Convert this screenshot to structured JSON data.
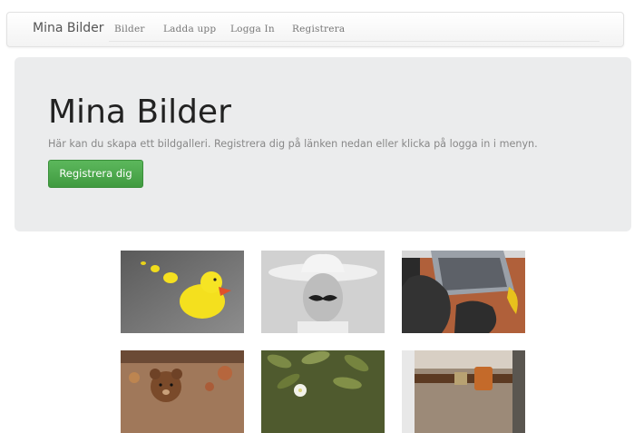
{
  "navbar": {
    "brand": "Mina Bilder",
    "items": [
      "Bilder",
      "Ladda upp",
      "Logga In",
      "Registrera"
    ]
  },
  "hero": {
    "title": "Mina Bilder",
    "text": "Här kan du skapa ett bildgalleri. Registrera dig på länken nedan eller klicka på logga in i menyn.",
    "button_label": "Registrera dig"
  },
  "gallery": {
    "images": [
      "rubber-ducks-photo",
      "cowboy-mustache-photo",
      "gorilla-laptop-photo",
      "teddy-bear-photo",
      "succulent-plant-photo",
      "belt-holster-photo"
    ]
  },
  "colors": {
    "button_green": "#4cae4c",
    "jumbotron_bg": "#ebeced"
  }
}
